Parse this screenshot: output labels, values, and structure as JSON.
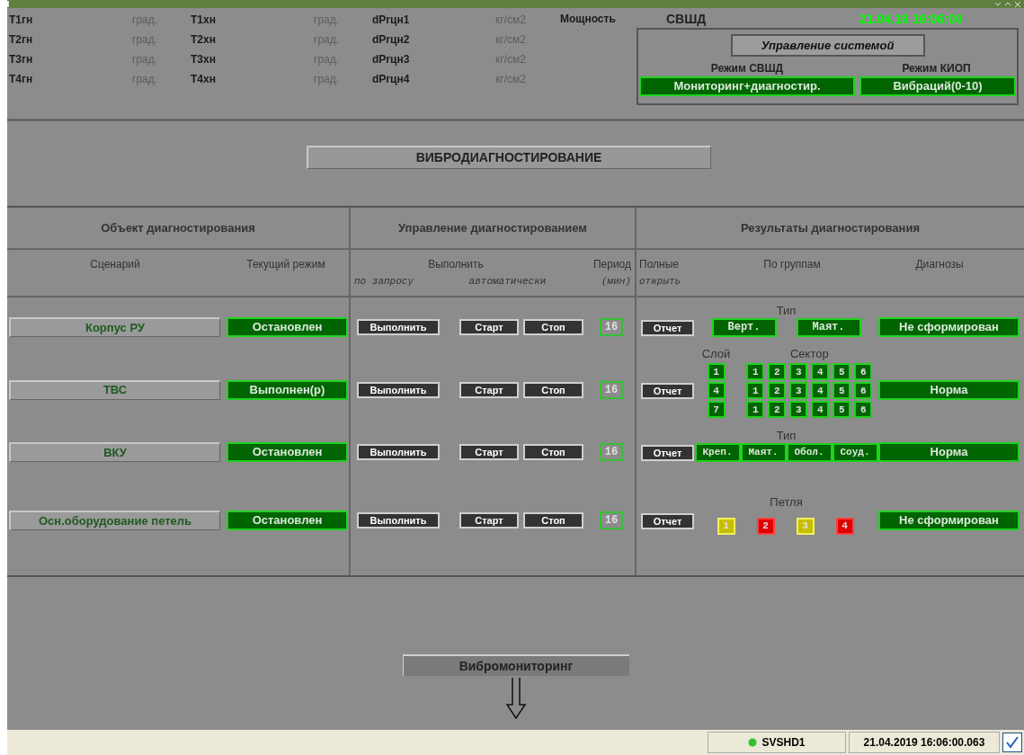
{
  "params": [
    [
      {
        "label": "T1гн",
        "unit": "град."
      },
      {
        "label": "T1хн",
        "unit": "град."
      },
      {
        "label": "dPrцн1",
        "unit": "кг/см2"
      }
    ],
    [
      {
        "label": "T2гн",
        "unit": "град."
      },
      {
        "label": "T2хн",
        "unit": "град."
      },
      {
        "label": "dPrцн2",
        "unit": "кг/см2"
      }
    ],
    [
      {
        "label": "T3гн",
        "unit": "град."
      },
      {
        "label": "T3хн",
        "unit": "град."
      },
      {
        "label": "dPrцн3",
        "unit": "кг/см2"
      }
    ],
    [
      {
        "label": "T4гн",
        "unit": "град."
      },
      {
        "label": "T4хн",
        "unit": "град."
      },
      {
        "label": "dPrцн4",
        "unit": "кг/см2"
      }
    ]
  ],
  "power": {
    "label": "Мощность",
    "value": "СВШД"
  },
  "clock": "21.04.19 16:06:00",
  "control": {
    "button": "Управление системой",
    "mode1_label": "Режим СВШД",
    "mode1_value": "Мониторинг+диагностир.",
    "mode2_label": "Режим КИОП",
    "mode2_value": "Вибраций(0-10)"
  },
  "section_title": "ВИБРОДИАГНОСТИРОВАНИЕ",
  "table": {
    "groups": [
      "Объект диагностирования",
      "Управление диагностированием",
      "Результаты диагностирования"
    ],
    "sub": {
      "scenario": "Сценарий",
      "mode": "Текущий режим",
      "execute": "Выполнить",
      "period": "Период",
      "on_request": "по запросу",
      "auto": "автоматически",
      "minutes": "(мин)",
      "full": "Полные",
      "open": "открыть",
      "by_groups": "По группам",
      "diagnoses": "Диагнозы"
    },
    "rows": [
      {
        "scenario": "Корпус РУ",
        "mode": "Остановлен",
        "execute": "Выполнить",
        "start": "Старт",
        "stop": "Стоп",
        "period": "16",
        "report": "Отчет",
        "result": {
          "kind": "types",
          "label": "Тип",
          "items": [
            "Верт.",
            "Маят."
          ]
        },
        "diagnosis": "Не сформирован"
      },
      {
        "scenario": "ТВС",
        "mode": "Выполнен(р)",
        "execute": "Выполнить",
        "start": "Старт",
        "stop": "Стоп",
        "period": "16",
        "report": "Отчет",
        "result": {
          "kind": "grid",
          "layer_label": "Слой",
          "sector_label": "Сектор",
          "layers": [
            {
              "label": "1",
              "sectors": [
                "1",
                "2",
                "3",
                "4",
                "5",
                "6"
              ]
            },
            {
              "label": "4",
              "sectors": [
                "1",
                "2",
                "3",
                "4",
                "5",
                "6"
              ]
            },
            {
              "label": "7",
              "sectors": [
                "1",
                "2",
                "3",
                "4",
                "5",
                "6"
              ]
            }
          ]
        },
        "diagnosis": "Норма"
      },
      {
        "scenario": "ВКУ",
        "mode": "Остановлен",
        "execute": "Выполнить",
        "start": "Старт",
        "stop": "Стоп",
        "period": "16",
        "report": "Отчет",
        "result": {
          "kind": "types_joined",
          "label": "Тип",
          "items": [
            "Креп.",
            "Маят.",
            "Обол.",
            "Соуд."
          ]
        },
        "diagnosis": "Норма"
      },
      {
        "scenario": "Осн.оборудование петель",
        "mode": "Остановлен",
        "execute": "Выполнить",
        "start": "Старт",
        "stop": "Стоп",
        "period": "16",
        "report": "Отчет",
        "result": {
          "kind": "loops",
          "label": "Петля",
          "items": [
            {
              "label": "1",
              "color": "#c8be00"
            },
            {
              "label": "2",
              "color": "#e00000"
            },
            {
              "label": "3",
              "color": "#c8be00"
            },
            {
              "label": "4",
              "color": "#e00000"
            }
          ]
        },
        "diagnosis": "Не сформирован"
      }
    ]
  },
  "monitoring_button": "Вибромониторинг",
  "status_bar": {
    "server": "SVSHD1",
    "datetime": "21.04.2019 16:06:00.063",
    "checked": true
  }
}
